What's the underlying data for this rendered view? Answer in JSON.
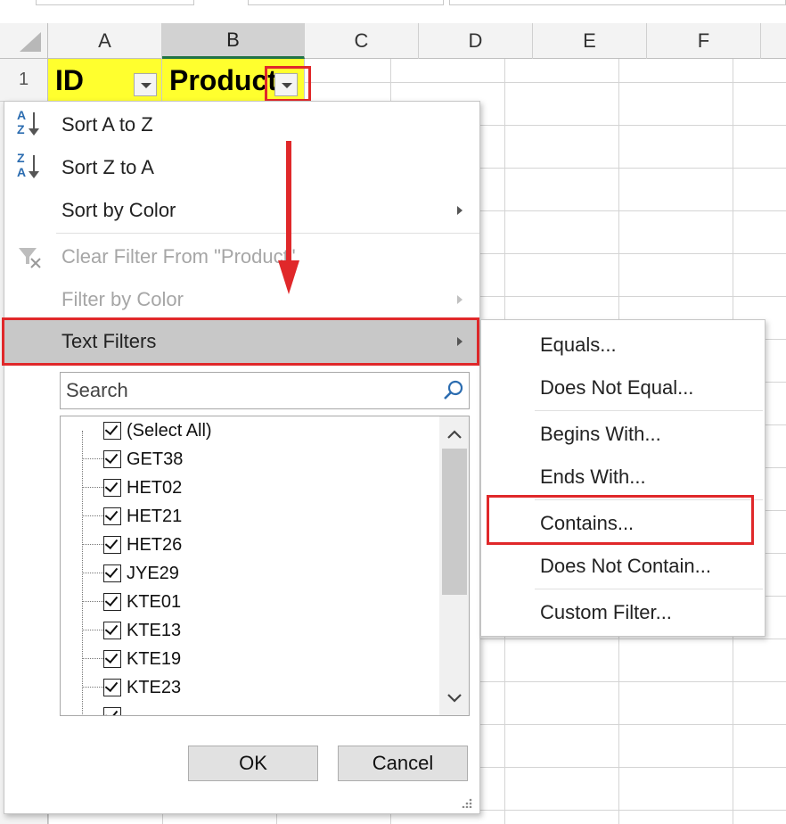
{
  "sheet": {
    "columns": [
      "A",
      "B",
      "C",
      "D",
      "E",
      "F"
    ],
    "selected_column": "B",
    "row_label": "1",
    "header_cells": [
      "ID",
      "Product"
    ]
  },
  "menu": {
    "sort_az": "Sort A to Z",
    "sort_za": "Sort Z to A",
    "sort_by_color": "Sort by Color",
    "clear_filter": "Clear Filter From \"Product\"",
    "filter_by_color": "Filter by Color",
    "text_filters": "Text Filters",
    "search_placeholder": "Search",
    "items": [
      "(Select All)",
      "GET38",
      "HET02",
      "HET21",
      "HET26",
      "JYE29",
      "KTE01",
      "KTE13",
      "KTE19",
      "KTE23"
    ],
    "ok": "OK",
    "cancel": "Cancel"
  },
  "submenu": {
    "items": [
      "Equals...",
      "Does Not Equal...",
      "Begins With...",
      "Ends With...",
      "Contains...",
      "Does Not Contain...",
      "Custom Filter..."
    ]
  },
  "colors": {
    "highlight_red": "#e0282a",
    "header_yellow": "#ffff2e",
    "excel_green": "#217346"
  }
}
